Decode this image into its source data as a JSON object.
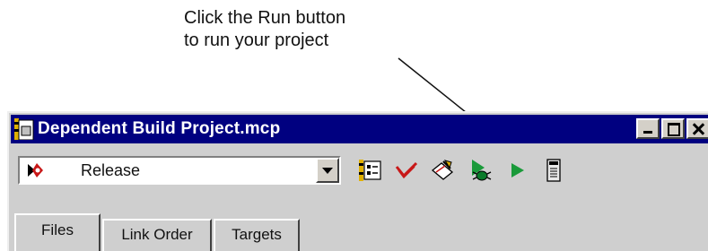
{
  "callout": {
    "line1": "Click the Run button",
    "line2": "to run your project"
  },
  "window": {
    "title": "Dependent Build Project.mcp",
    "controls": [
      "minimize",
      "maximize",
      "close"
    ]
  },
  "toolbar": {
    "target_select": {
      "value": "Release",
      "icon": "target-icon"
    },
    "buttons": [
      {
        "name": "settings-icon"
      },
      {
        "name": "synchronize-check-icon"
      },
      {
        "name": "make-icon"
      },
      {
        "name": "debug-icon"
      },
      {
        "name": "run-icon"
      },
      {
        "name": "project-inspector-icon"
      }
    ]
  },
  "tabs": [
    {
      "label": "Files",
      "active": true
    },
    {
      "label": "Link Order",
      "active": false
    },
    {
      "label": "Targets",
      "active": false
    }
  ],
  "colors": {
    "titlebar": "#000080",
    "chrome": "#cfcfcf",
    "run_green": "#1a9a3a"
  }
}
